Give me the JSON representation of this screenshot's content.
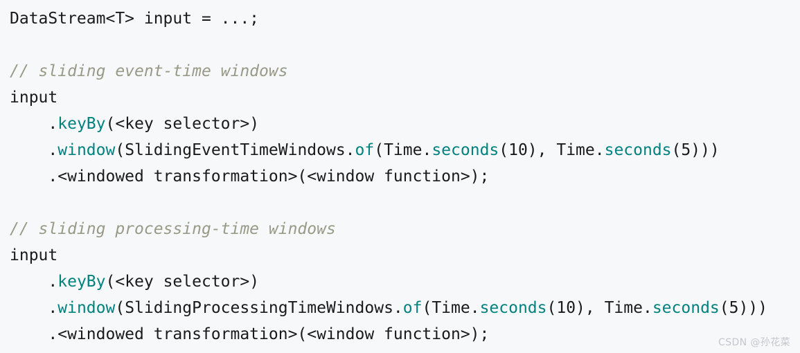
{
  "page": {
    "background_color": "#f7f8fa",
    "kind": "code-snippet"
  },
  "theme": {
    "plain_color": "#1a1a1a",
    "method_color": "#00827f",
    "comment_color": "#999988",
    "watermark_color": "#c3c6cc"
  },
  "code": {
    "language": "java",
    "lines": [
      {
        "tokens": [
          {
            "t": "DataStream<T> input = ...;",
            "k": "plain"
          }
        ]
      },
      {
        "tokens": []
      },
      {
        "tokens": [
          {
            "t": "// sliding event-time windows",
            "k": "comment"
          }
        ]
      },
      {
        "tokens": [
          {
            "t": "input",
            "k": "plain"
          }
        ]
      },
      {
        "tokens": [
          {
            "t": "    .",
            "k": "plain"
          },
          {
            "t": "keyBy",
            "k": "method"
          },
          {
            "t": "(<key selector>)",
            "k": "plain"
          }
        ]
      },
      {
        "tokens": [
          {
            "t": "    .",
            "k": "plain"
          },
          {
            "t": "window",
            "k": "method"
          },
          {
            "t": "(SlidingEventTimeWindows.",
            "k": "plain"
          },
          {
            "t": "of",
            "k": "method"
          },
          {
            "t": "(Time.",
            "k": "plain"
          },
          {
            "t": "seconds",
            "k": "method"
          },
          {
            "t": "(10), Time.",
            "k": "plain"
          },
          {
            "t": "seconds",
            "k": "method"
          },
          {
            "t": "(5)))",
            "k": "plain"
          }
        ]
      },
      {
        "tokens": [
          {
            "t": "    .<windowed transformation>(<window function>);",
            "k": "plain"
          }
        ]
      },
      {
        "tokens": []
      },
      {
        "tokens": [
          {
            "t": "// sliding processing-time windows",
            "k": "comment"
          }
        ]
      },
      {
        "tokens": [
          {
            "t": "input",
            "k": "plain"
          }
        ]
      },
      {
        "tokens": [
          {
            "t": "    .",
            "k": "plain"
          },
          {
            "t": "keyBy",
            "k": "method"
          },
          {
            "t": "(<key selector>)",
            "k": "plain"
          }
        ]
      },
      {
        "tokens": [
          {
            "t": "    .",
            "k": "plain"
          },
          {
            "t": "window",
            "k": "method"
          },
          {
            "t": "(SlidingProcessingTimeWindows.",
            "k": "plain"
          },
          {
            "t": "of",
            "k": "method"
          },
          {
            "t": "(Time.",
            "k": "plain"
          },
          {
            "t": "seconds",
            "k": "method"
          },
          {
            "t": "(10), Time.",
            "k": "plain"
          },
          {
            "t": "seconds",
            "k": "method"
          },
          {
            "t": "(5)))",
            "k": "plain"
          }
        ]
      },
      {
        "tokens": [
          {
            "t": "    .<windowed transformation>(<window function>);",
            "k": "plain"
          }
        ]
      }
    ]
  },
  "watermark": {
    "text": "CSDN @孙花菜"
  }
}
